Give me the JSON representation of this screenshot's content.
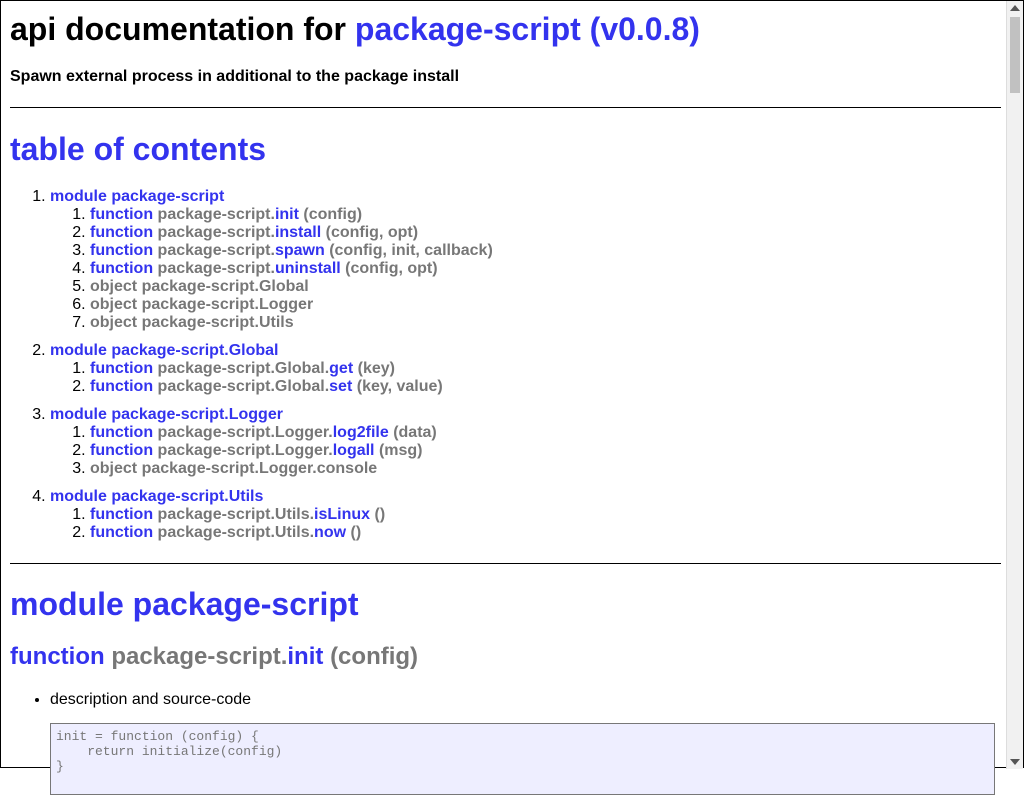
{
  "header": {
    "title_prefix": "api documentation for",
    "title_link": "package-script (v0.0.8)",
    "subtitle": "Spawn external process in additional to the package install"
  },
  "toc": {
    "title": "table of contents",
    "modules": [
      {
        "label": "module package-script",
        "items": [
          {
            "kind": "function",
            "prefix": "package-script.",
            "name": "init",
            "args": "(config)"
          },
          {
            "kind": "function",
            "prefix": "package-script.",
            "name": "install",
            "args": "(config, opt)"
          },
          {
            "kind": "function",
            "prefix": "package-script.",
            "name": "spawn",
            "args": "(config, init, callback)"
          },
          {
            "kind": "function",
            "prefix": "package-script.",
            "name": "uninstall",
            "args": "(config, opt)"
          },
          {
            "kind": "object",
            "text": "object package-script.Global"
          },
          {
            "kind": "object",
            "text": "object package-script.Logger"
          },
          {
            "kind": "object",
            "text": "object package-script.Utils"
          }
        ]
      },
      {
        "label": "module package-script.Global",
        "items": [
          {
            "kind": "function",
            "prefix": "package-script.Global.",
            "name": "get",
            "args": "(key)"
          },
          {
            "kind": "function",
            "prefix": "package-script.Global.",
            "name": "set",
            "args": "(key, value)"
          }
        ]
      },
      {
        "label": "module package-script.Logger",
        "items": [
          {
            "kind": "function",
            "prefix": "package-script.Logger.",
            "name": "log2file",
            "args": "(data)"
          },
          {
            "kind": "function",
            "prefix": "package-script.Logger.",
            "name": "logall",
            "args": "(msg)"
          },
          {
            "kind": "object",
            "text": "object package-script.Logger.console"
          }
        ]
      },
      {
        "label": "module package-script.Utils",
        "items": [
          {
            "kind": "function",
            "prefix": "package-script.Utils.",
            "name": "isLinux",
            "args": "()"
          },
          {
            "kind": "function",
            "prefix": "package-script.Utils.",
            "name": "now",
            "args": "()"
          }
        ]
      }
    ]
  },
  "section": {
    "module_title": "module package-script",
    "fn_keyword": "function",
    "fn_prefix": "package-script.",
    "fn_name": "init",
    "fn_args": "(config)",
    "bullet": "description and source-code",
    "code": "init = function (config) {\n    return initialize(config)\n}"
  },
  "labels": {
    "function": "function"
  }
}
